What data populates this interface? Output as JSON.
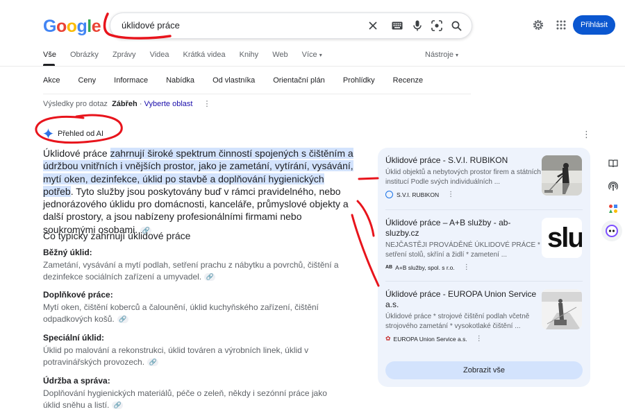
{
  "logo": {
    "letters": [
      "G",
      "o",
      "o",
      "g",
      "l",
      "e"
    ],
    "colors": [
      "#4285f4",
      "#ea4335",
      "#fbbc05",
      "#4285f4",
      "#34a853",
      "#ea4335"
    ]
  },
  "search": {
    "query": "úklidové práce"
  },
  "header": {
    "signin_label": "Přihlásit"
  },
  "tabs": [
    {
      "label": "Vše"
    },
    {
      "label": "Obrázky"
    },
    {
      "label": "Zprávy"
    },
    {
      "label": "Videa"
    },
    {
      "label": "Krátká videa"
    },
    {
      "label": "Knihy"
    },
    {
      "label": "Web"
    },
    {
      "label": "Více"
    }
  ],
  "tools_label": "Nástroje",
  "chips": [
    "Akce",
    "Ceny",
    "Informace",
    "Nabídka",
    "Od vlastníka",
    "Orientační plán",
    "Prohlídky",
    "Recenze"
  ],
  "location": {
    "prefix": "Výsledky pro dotaz",
    "place": "Zábřeh",
    "sep": "·",
    "link": "Vyberte oblast"
  },
  "ai": {
    "header": "Přehled od AI",
    "intro_plain": "Úklidové práce ",
    "intro_highlight": "zahrnují široké spektrum činností spojených s čištěním a údržbou vnitřních i vnějších prostor, jako je zametání, vytírání, vysávání, mytí oken, dezinfekce, úklid po stavbě a doplňování hygienických potřeb",
    "intro_rest": ". Tyto služby jsou poskytovány buď v rámci pravidelného, nebo jednorázového úklidu pro domácnosti, kanceláře, průmyslové objekty a další prostory, a jsou nabízeny profesionálními firmami nebo soukromými osobami.",
    "section_title": "Co typicky zahrnují úklidové práce",
    "items": [
      {
        "title": "Běžný úklid:",
        "text": "Zametání, vysávání a mytí podlah, setření prachu z nábytku a povrchů, čištění a dezinfekce sociálních zařízení a umyvadel."
      },
      {
        "title": "Doplňkové práce:",
        "text": "Mytí oken, čištění koberců a čalounění, úklid kuchyňského zařízení, čištění odpadkových košů."
      },
      {
        "title": "Speciální úklid:",
        "text": "Úklid po malování a rekonstrukci, úklid továren a výrobních linek, úklid v potravinářských provozech."
      },
      {
        "title": "Údržba a správa:",
        "text": "Doplňování hygienických materiálů, péče o zeleň, někdy i sezónní práce jako úklid sněhu a listí."
      }
    ]
  },
  "sources": [
    {
      "title": "Úklidové práce - S.V.I. RUBIKON",
      "desc": "Úklid objektů a nebytových prostor firem a státních institucí Podle svých individuálních ...",
      "site": "S.V.I. RUBIKON"
    },
    {
      "title": "Úklidové práce – A+B služby - ab-sluzby.cz",
      "desc": "NEJČASTĚJI PROVÁDĚNÉ ÚKLIDOVÉ PRÁCE * setření stolů, skříní a židlí * zametení ...",
      "site": "A+B služby, spol. s r.o.",
      "thumb_text": "slu"
    },
    {
      "title": "Úklidové práce - EUROPA Union Service a.s.",
      "desc": "Úklidové práce * strojové čištění podlah včetně strojového zametání * vysokotlaké čištění ...",
      "site": "EUROPA Union Service a.s."
    }
  ],
  "show_all_label": "Zobrazit vše",
  "colors": {
    "accent": "#0b57d0",
    "highlight": "#d3e3fd",
    "panel": "#eef3fc",
    "annotation": "#e8141c"
  }
}
